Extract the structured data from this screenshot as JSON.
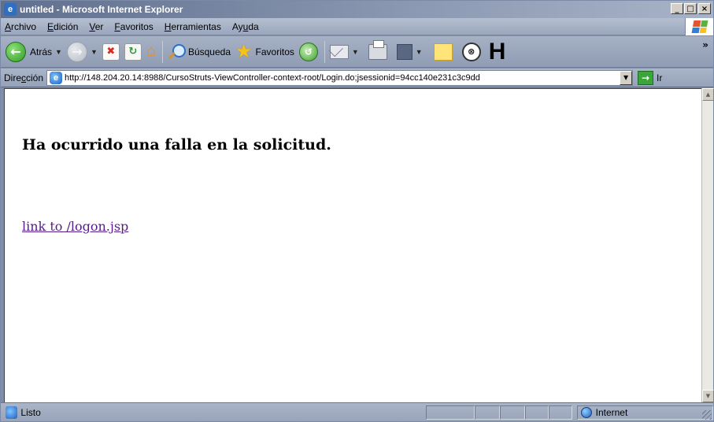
{
  "window": {
    "title": "untitled - Microsoft Internet Explorer"
  },
  "menu": {
    "items": [
      {
        "underline": "A",
        "rest": "rchivo"
      },
      {
        "underline": "E",
        "rest": "dición"
      },
      {
        "underline": "V",
        "rest": "er"
      },
      {
        "underline": "F",
        "rest": "avoritos"
      },
      {
        "underline": "H",
        "rest": "erramientas"
      },
      {
        "pre": "Ay",
        "underline": "u",
        "rest": "da"
      }
    ]
  },
  "toolbar": {
    "back_label": "Atrás",
    "search_label": "Búsqueda",
    "favorites_label": "Favoritos",
    "more": "»",
    "h_label": "H"
  },
  "address": {
    "label_pre": "Dire",
    "label_u": "c",
    "label_post": "ción",
    "url": "http://148.204.20.14:8988/CursoStruts-ViewController-context-root/Login.do;jsessionid=94cc140e231c3c9dd",
    "go_label": "Ir"
  },
  "content": {
    "heading": "Ha ocurrido una falla en la solicitud.",
    "link_text": "link to /logon.jsp"
  },
  "status": {
    "text": "Listo",
    "zone": "Internet"
  }
}
